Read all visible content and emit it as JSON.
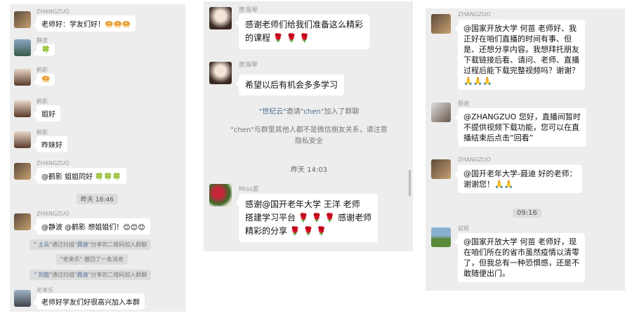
{
  "panel1": {
    "m1": {
      "name": "ZHANGZUO",
      "text": "老师好：学友们好！🥯🥯🥯"
    },
    "m2": {
      "name": "静波",
      "text": "🍀"
    },
    "m3": {
      "name": "鹤影",
      "text": "🥯"
    },
    "m4": {
      "name": "鹤影",
      "text": "姐好"
    },
    "m5": {
      "name": "鹤影",
      "text": "昨妹好"
    },
    "m6": {
      "name": "ZHANGZUO",
      "text": "@鹤影 姐姐同好 🍀🍀🍀"
    },
    "time1": "昨天 18:46",
    "m7": {
      "name": "ZHANGZUO",
      "text": "@静波 @鹤影 想姐姐们！😊😊😊"
    },
    "sys1": {
      "a": "\" 土兵",
      "b": "\"通过扫描\"",
      "c": "聂迪",
      "d": "\"分享的二维码加入群聊"
    },
    "sys2": "\"老来乐\" 撤回了一条消息",
    "sys3": {
      "a": "\" 刘茵",
      "b": "\"通过扫描\"",
      "c": "聂迪",
      "d": "\"分享的二维码加入群聊"
    },
    "m8": {
      "name": "老来乐",
      "text": "老师好学友们好很高兴加入本群"
    }
  },
  "panel2": {
    "m1": {
      "name": "廖海琴",
      "text": "感谢老师们给我们准备这么精彩\n的课程 🌹 🌹 🌹"
    },
    "m2": {
      "name": "廖海琴",
      "text": "希望以后有机会多多学习"
    },
    "sys1": {
      "a": "\"世纪云\"",
      "b": "邀请\"",
      "c": "chen",
      "d": "\"加入了群聊"
    },
    "sys2": "\"chen\"与群里其他人都不是微信朋友关系，请注意\n隐私安全",
    "time1": "昨天 14:03",
    "m3": {
      "name": "Miss姜",
      "text": "感谢@国开老年大学 王洋  老师\n搭建学习平台 🌹 🌹 🌹 感谢老师\n精彩的分享 🌹 🌹 🌹"
    }
  },
  "panel3": {
    "m1": {
      "name": "ZHANGZUO",
      "text": "@国家开放大学 何苗 老师好、我\n正好在咱们直播的时间有事、但\n是、还想分享内容。我想拜托朋友\n下载链接后看、请问、老师、直播\n过程后能下载完整视频吗？谢谢？\n🙏🙏🙏"
    },
    "m2": {
      "name": "聂迪",
      "text": "@ZHANGZUO 您好，直播间暂时\n不提供视频下载功能，您可以在直\n播结束后点击“回看”"
    },
    "m3": {
      "name": "ZHANGZUO",
      "text": "@国开老年大学-聂迪 好的老师：\n谢谢您！🙏🙏"
    },
    "time1": "09:16",
    "m4": {
      "name": "前辉",
      "text": "@国家开放大学 何苗 老师好，现\n在咱们所在的省市虽然疫情以清零\n了，但我总有一种恐惧感，还是不\n敢随便出门。"
    }
  }
}
